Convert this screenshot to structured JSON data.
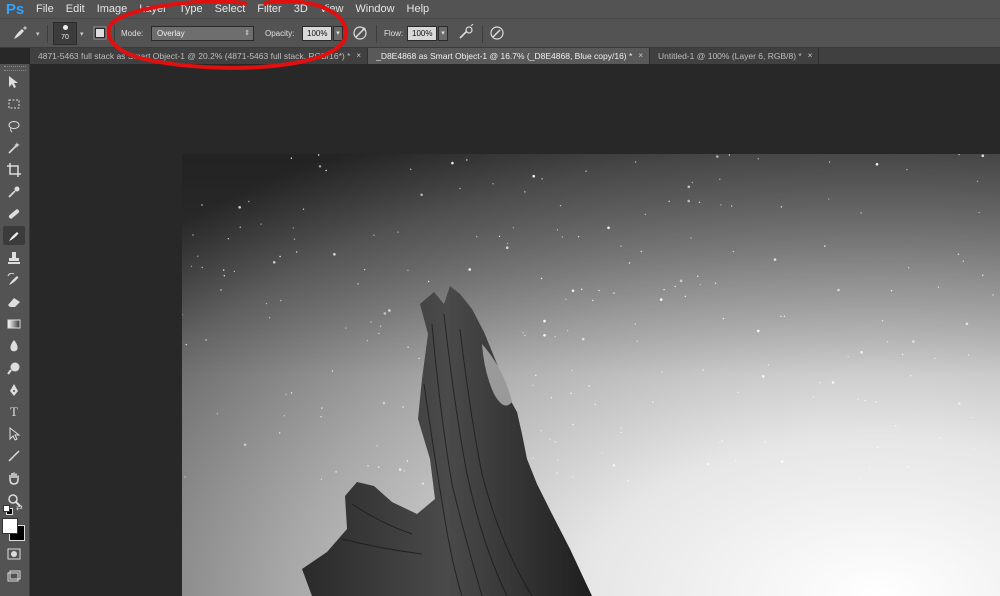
{
  "app": {
    "logo": "Ps"
  },
  "menu": [
    "File",
    "Edit",
    "Image",
    "Layer",
    "Type",
    "Select",
    "Filter",
    "3D",
    "View",
    "Window",
    "Help"
  ],
  "options": {
    "brush_size": "70",
    "mode_label": "Mode:",
    "mode_value": "Overlay",
    "opacity_label": "Opacity:",
    "opacity_value": "100%",
    "flow_label": "Flow:",
    "flow_value": "100%"
  },
  "tabs": [
    {
      "label": "4871-5463 full stack as Smart Object-1 @ 20.2% (4871-5463 full stack, RGB/16*) *",
      "close": "×",
      "active": false
    },
    {
      "label": "_D8E4868 as Smart Object-1 @ 16.7% (_D8E4868, Blue copy/16) *",
      "close": "×",
      "active": true
    },
    {
      "label": "Untitled-1 @ 100% (Layer 6, RGB/8) *",
      "close": "×",
      "active": false
    }
  ],
  "tools": [
    "move-tool-icon",
    "marquee-tool-icon",
    "lasso-tool-icon",
    "magic-wand-icon",
    "crop-tool-icon",
    "eyedropper-icon",
    "healing-brush-icon",
    "brush-tool-icon",
    "clone-stamp-icon",
    "history-brush-icon",
    "eraser-icon",
    "gradient-tool-icon",
    "blur-tool-icon",
    "dodge-tool-icon",
    "pen-tool-icon",
    "type-tool-icon",
    "path-selection-icon",
    "line-tool-icon",
    "hand-tool-icon",
    "zoom-tool-icon"
  ],
  "colors": {
    "accent_ps": "#2fa3ff",
    "annotation_red": "#e01010",
    "foreground": "#ffffff",
    "background": "#000000"
  }
}
